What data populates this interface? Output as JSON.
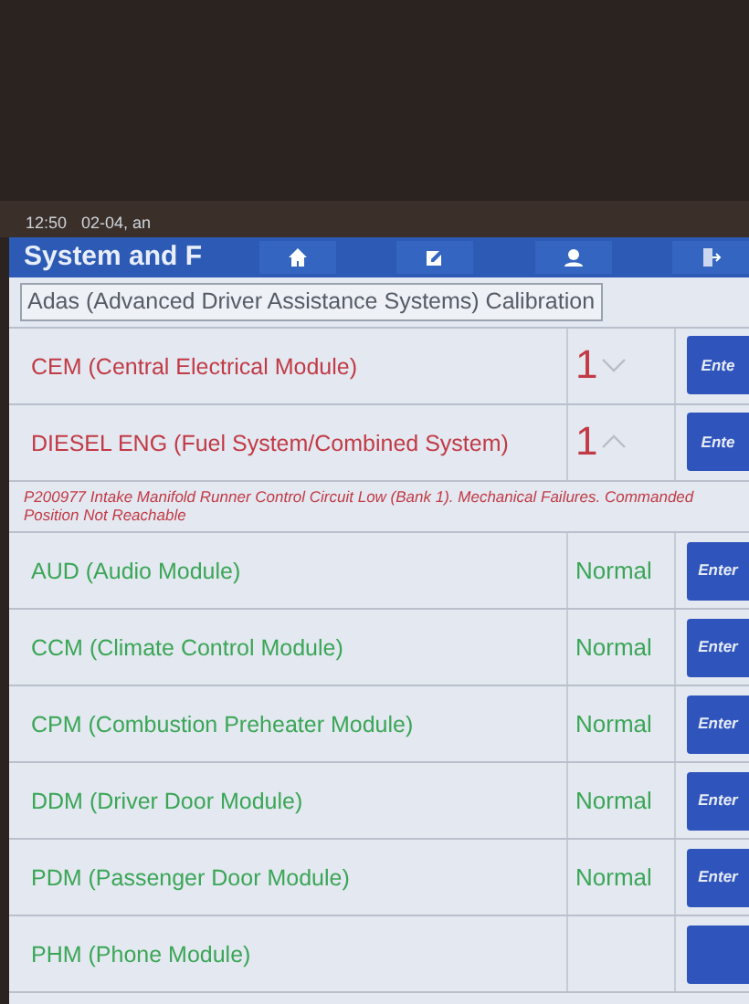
{
  "status_bar": {
    "time": "12:50",
    "date": "02-04, an"
  },
  "header": {
    "title": "System and F"
  },
  "calibration_label": "Adas (Advanced Driver Assistance Systems) Calibration",
  "modules": [
    {
      "kind": "fault",
      "name": "CEM (Central Electrical Module)",
      "count": "1",
      "expanded": false,
      "button": "Ente"
    },
    {
      "kind": "fault",
      "name": "DIESEL ENG (Fuel System/Combined System)",
      "count": "1",
      "expanded": true,
      "button": "Ente",
      "detail": "P200977 Intake Manifold Runner Control Circuit Low (Bank 1). Mechanical Failures. Commanded Position Not Reachable"
    },
    {
      "kind": "normal",
      "name": "AUD (Audio Module)",
      "status": "Normal",
      "button": "Enter"
    },
    {
      "kind": "normal",
      "name": "CCM (Climate Control Module)",
      "status": "Normal",
      "button": "Enter"
    },
    {
      "kind": "normal",
      "name": "CPM (Combustion Preheater Module)",
      "status": "Normal",
      "button": "Enter"
    },
    {
      "kind": "normal",
      "name": "DDM (Driver Door Module)",
      "status": "Normal",
      "button": "Enter"
    },
    {
      "kind": "normal",
      "name": "PDM (Passenger Door Module)",
      "status": "Normal",
      "button": "Enter"
    },
    {
      "kind": "partial",
      "name": "PHM (Phone Module)"
    }
  ]
}
